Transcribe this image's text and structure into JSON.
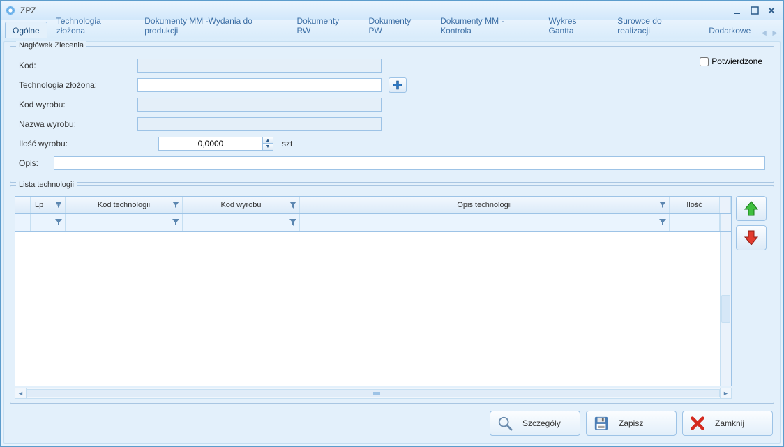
{
  "window": {
    "title": "ZPZ"
  },
  "tabs": [
    "Ogólne",
    "Technologia złożona",
    "Dokumenty MM -Wydania do produkcji",
    "Dokumenty RW",
    "Dokumenty PW",
    "Dokumenty MM - Kontrola",
    "Wykres Gantta",
    "Surowce do realizacji",
    "Dodatkowe"
  ],
  "active_tab_index": 0,
  "header_group": {
    "legend": "Nagłówek Zlecenia",
    "labels": {
      "kod": "Kod:",
      "technologia": "Technologia złożona:",
      "kod_wyrobu": "Kod wyrobu:",
      "nazwa_wyrobu": "Nazwa wyrobu:",
      "ilosc_wyrobu": "Ilość wyrobu:",
      "opis": "Opis:"
    },
    "values": {
      "kod": "",
      "technologia": "",
      "kod_wyrobu": "",
      "nazwa_wyrobu": "",
      "ilosc_wyrobu": "0,0000",
      "unit": "szt",
      "opis": ""
    },
    "confirm_label": "Potwierdzone",
    "confirm_checked": false
  },
  "list_group": {
    "legend": "Lista technologii",
    "columns": [
      "Lp",
      "Kod technologii",
      "Kod wyrobu",
      "Opis technologii",
      "Ilość"
    ],
    "rows": []
  },
  "buttons": {
    "details": "Szczegóły",
    "save": "Zapisz",
    "close": "Zamknij"
  }
}
